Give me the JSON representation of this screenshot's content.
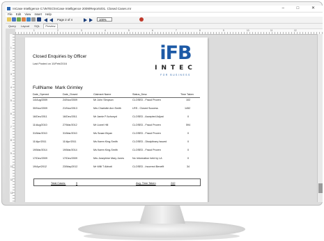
{
  "window": {
    "title": "InCase Intelligence  C:\\INTEC\\InCase Intelligence 2009\\Reports\\01. Closed Cases.rnr",
    "controls": [
      "–",
      "□",
      "✕"
    ]
  },
  "menu": [
    "File",
    "Edit",
    "View",
    "Insert",
    "Help"
  ],
  "toolbar": {
    "page_label": "Page 2 of 4",
    "zoom": "100%"
  },
  "tabs": [
    {
      "label": "Query"
    },
    {
      "label": "Layout"
    },
    {
      "label": "SQL"
    },
    {
      "label": "Preview"
    }
  ],
  "ruler": {
    "h": [
      "1",
      "2",
      "3",
      "4",
      "5",
      "6",
      "7",
      "8",
      "9",
      "10",
      "11",
      "12"
    ],
    "v": [
      "1",
      "2",
      "3",
      "4",
      "5",
      "6",
      "7",
      "8",
      "9",
      "10",
      "11",
      "12"
    ]
  },
  "report": {
    "title": "Closed Enquiries by Officer",
    "last_posted": "Last Posted on 10/Feb/2016",
    "logo": {
      "brand": "iFB",
      "sub": "INTEC",
      "tagline": "FOR BUSINESS"
    },
    "fullname_label": "FullName",
    "fullname_value": "Mark Grimley",
    "columns": [
      "Date_Opened",
      "Date_Closed",
      "Claimant Name",
      "Status_Desc",
      "Time Taken"
    ],
    "rows": [
      [
        "14/Aug/2009",
        "24/Nov/2009",
        "Mr John Simpson",
        "CLOSED - Fraud Proven",
        "102"
      ],
      [
        "30/Nov/2009",
        "21/Nov/2013",
        "Mrs Charlotte Ann Smith",
        "LRS - Closed Success",
        "1452"
      ],
      [
        "16/Dec/2011",
        "16/Dec/2011",
        "Mr Jamie P Achonyd",
        "CLOSED - Accepted Adjust",
        "0"
      ],
      [
        "11/Aug/2010",
        "27/Mar/2012",
        "Mr Lionel Hill",
        "CLOSED - Fraud Proven",
        "594"
      ],
      [
        "31/Mar/2010",
        "31/Mar/2010",
        "Ms Susan Bryan",
        "CLOSED - Fraud Proven",
        "0"
      ],
      [
        "11/Apr/2011",
        "11/Apr/2011",
        "Ms Karen King-Smith",
        "CLOSED - Disciplinary Issued",
        "0"
      ],
      [
        "19/Mar/2014",
        "19/Mar/2014",
        "Ms Karen King-Smith",
        "CLOSED - Fraud Proven",
        "0"
      ],
      [
        "17/Dec/2009",
        "17/Dec/2009",
        "Mrs Josephine Mary Jones",
        "No Information held by LA",
        "0"
      ],
      [
        "19/Apr/2012",
        "23/May/2012",
        "Mr Willi T Abbott",
        "CLOSED - Incorrect Benefit",
        "34"
      ]
    ],
    "total_cases_label": "Total Cases:",
    "total_cases_value": "9",
    "avg_time_label": "Avg. Time Taken",
    "avg_time_value": "242"
  },
  "colors": {
    "brand_blue": "#1d5aa6"
  }
}
